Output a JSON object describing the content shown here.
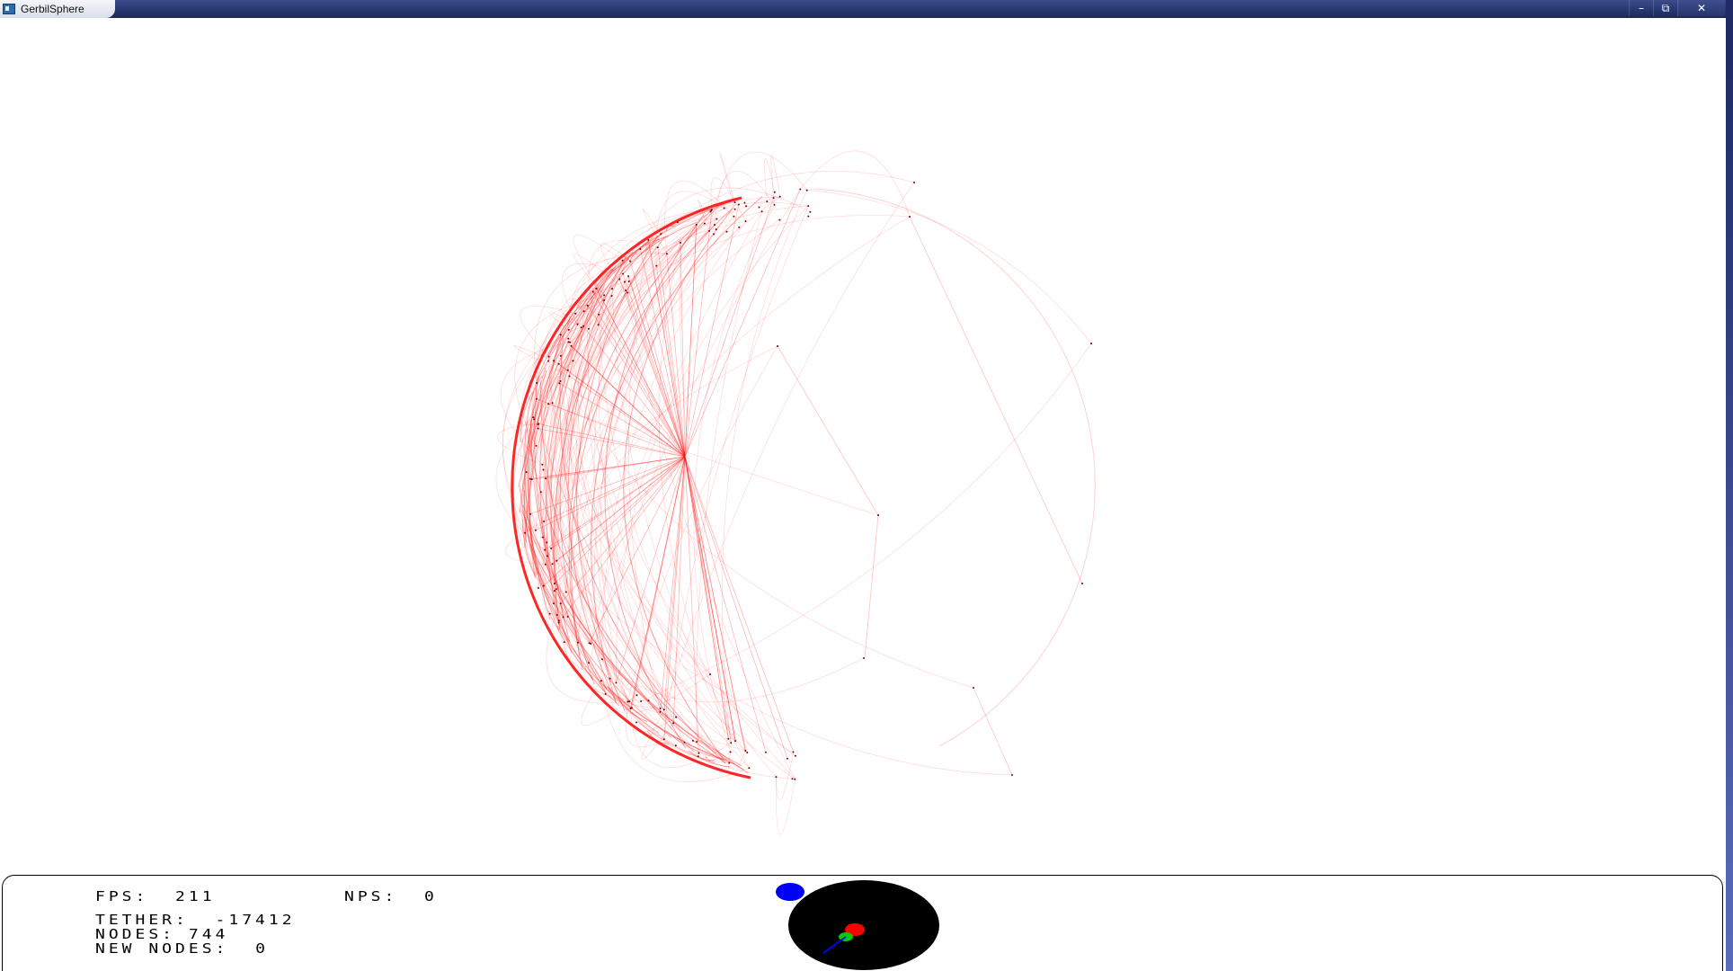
{
  "window": {
    "title": "GerbilSphere",
    "controls": {
      "minimize": "–",
      "maximize": "⧉",
      "close": "✕"
    }
  },
  "hud": {
    "fps_label": "FPS:",
    "fps_value": "211",
    "nps_label": "NPS:",
    "nps_value": "0",
    "tether_label": "TETHER:",
    "tether_value": "-17412",
    "nodes_label": "NODES:",
    "nodes_value": "744",
    "new_nodes_label": "NEW NODES:",
    "new_nodes_value": "0"
  },
  "colors": {
    "edge": "#ff0000",
    "background": "#ffffff",
    "gizmo_sphere": "#000000",
    "gizmo_blue": "#0000ff",
    "gizmo_red": "#ff0000",
    "gizmo_green": "#00cc00"
  }
}
